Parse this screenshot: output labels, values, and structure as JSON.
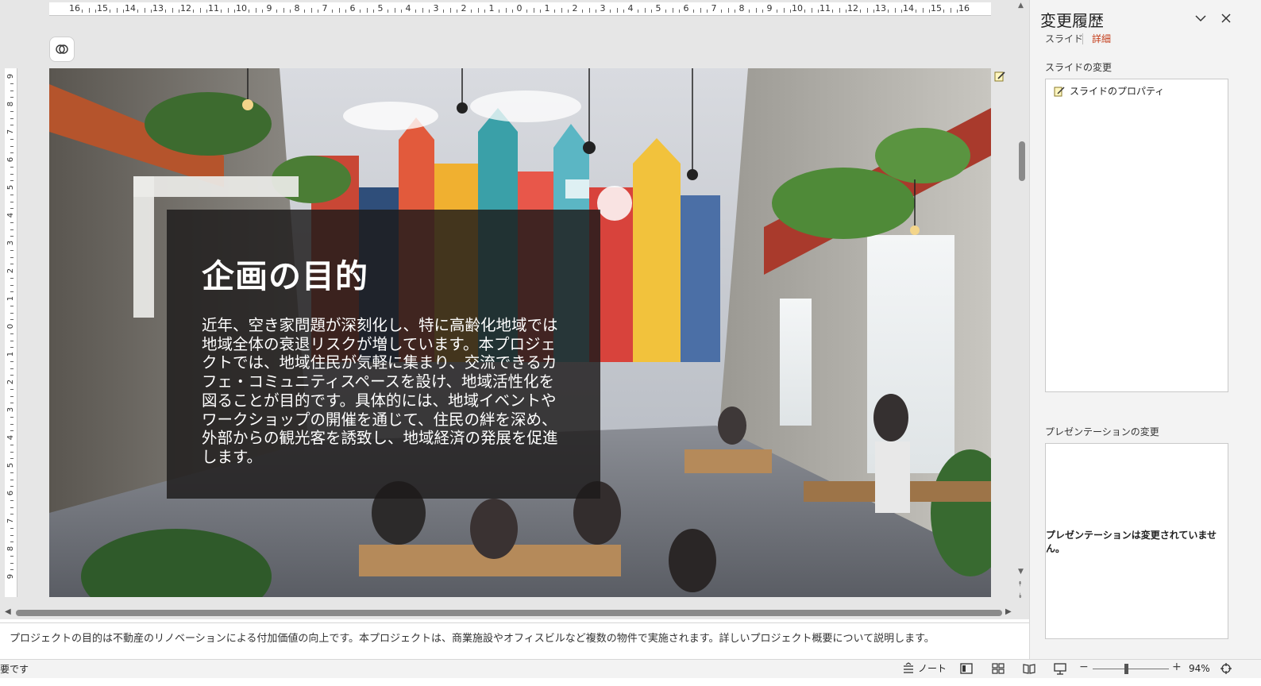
{
  "ruler": {
    "horizontal_labels": [
      "16",
      "15",
      "14",
      "13",
      "12",
      "11",
      "10",
      "9",
      "8",
      "7",
      "6",
      "5",
      "4",
      "3",
      "2",
      "1",
      "0",
      "1",
      "2",
      "3",
      "4",
      "5",
      "6",
      "7",
      "8",
      "9",
      "10",
      "11",
      "12",
      "13",
      "14",
      "15",
      "16"
    ],
    "vertical_labels": [
      "9",
      "8",
      "7",
      "6",
      "5",
      "4",
      "3",
      "2",
      "1",
      "0",
      "1",
      "2",
      "3",
      "4",
      "5",
      "6",
      "7",
      "8",
      "9"
    ]
  },
  "slide": {
    "title": "企画の目的",
    "body": "近年、空き家問題が深刻化し、特に高齢化地域では地域全体の衰退リスクが増しています。本プロジェクトでは、地域住民が気軽に集まり、交流できるカフェ・コミュニティスペースを設け、地域活性化を図ることが目的です。具体的には、地域イベントやワークショップの開催を通じて、住民の絆を深め、外部からの観光客を誘致し、地域経済の発展を促進します。"
  },
  "notes": {
    "text": "プロジェクトの目的は不動産のリノベーションによる付加価値の向上です。本プロジェクトは、商業施設やオフィスビルなど複数の物件で実施されます。詳しいプロジェクト概要について説明します。"
  },
  "pane": {
    "title": "変更履歴",
    "tabs": [
      {
        "label": "スライド",
        "active": false
      },
      {
        "label": "詳細",
        "active": true
      }
    ],
    "slide_changes_label": "スライドの変更",
    "slide_changes_items": [
      "スライドのプロパティ"
    ],
    "presentation_changes_label": "プレゼンテーションの変更",
    "presentation_empty_message": "プレゼンテーションは変更されていません。"
  },
  "status": {
    "left_text": "要です",
    "notes_label": "ノート",
    "zoom": "94%",
    "zoom_fraction": 0.44
  },
  "icons": [
    "copilot-icon",
    "edit-marker-icon",
    "chevron-down-icon",
    "close-icon",
    "slide-property-icon",
    "notes-icon",
    "normal-view-icon",
    "slide-sorter-icon",
    "reading-view-icon",
    "slideshow-icon",
    "fit-slide-icon"
  ],
  "colors": {
    "accent": "#c43e1c",
    "panel": "#1c1a1a",
    "pane_bg": "#f3f3f3"
  }
}
